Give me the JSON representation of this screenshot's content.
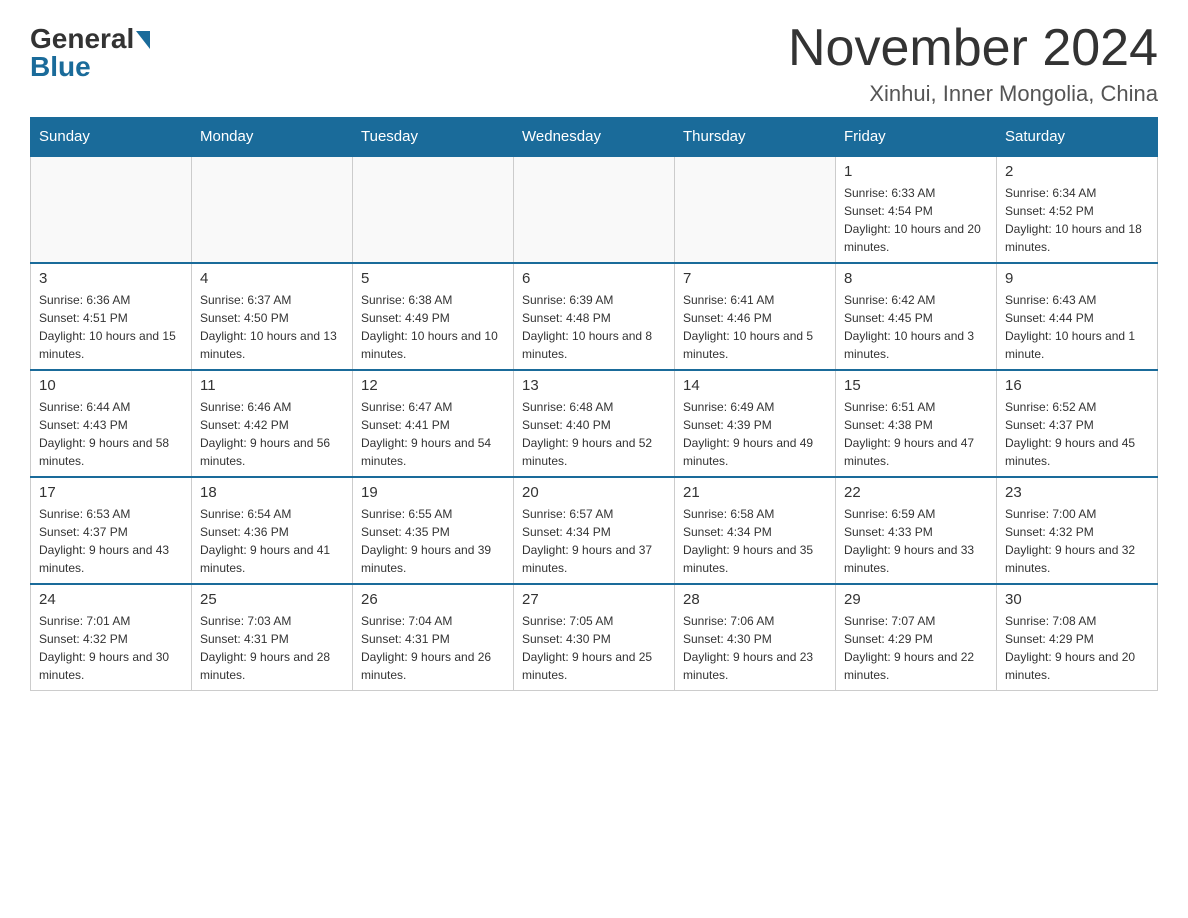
{
  "header": {
    "logo_general": "General",
    "logo_blue": "Blue",
    "month_title": "November 2024",
    "location": "Xinhui, Inner Mongolia, China"
  },
  "calendar": {
    "days_of_week": [
      "Sunday",
      "Monday",
      "Tuesday",
      "Wednesday",
      "Thursday",
      "Friday",
      "Saturday"
    ],
    "weeks": [
      [
        {
          "day": "",
          "info": ""
        },
        {
          "day": "",
          "info": ""
        },
        {
          "day": "",
          "info": ""
        },
        {
          "day": "",
          "info": ""
        },
        {
          "day": "",
          "info": ""
        },
        {
          "day": "1",
          "info": "Sunrise: 6:33 AM\nSunset: 4:54 PM\nDaylight: 10 hours and 20 minutes."
        },
        {
          "day": "2",
          "info": "Sunrise: 6:34 AM\nSunset: 4:52 PM\nDaylight: 10 hours and 18 minutes."
        }
      ],
      [
        {
          "day": "3",
          "info": "Sunrise: 6:36 AM\nSunset: 4:51 PM\nDaylight: 10 hours and 15 minutes."
        },
        {
          "day": "4",
          "info": "Sunrise: 6:37 AM\nSunset: 4:50 PM\nDaylight: 10 hours and 13 minutes."
        },
        {
          "day": "5",
          "info": "Sunrise: 6:38 AM\nSunset: 4:49 PM\nDaylight: 10 hours and 10 minutes."
        },
        {
          "day": "6",
          "info": "Sunrise: 6:39 AM\nSunset: 4:48 PM\nDaylight: 10 hours and 8 minutes."
        },
        {
          "day": "7",
          "info": "Sunrise: 6:41 AM\nSunset: 4:46 PM\nDaylight: 10 hours and 5 minutes."
        },
        {
          "day": "8",
          "info": "Sunrise: 6:42 AM\nSunset: 4:45 PM\nDaylight: 10 hours and 3 minutes."
        },
        {
          "day": "9",
          "info": "Sunrise: 6:43 AM\nSunset: 4:44 PM\nDaylight: 10 hours and 1 minute."
        }
      ],
      [
        {
          "day": "10",
          "info": "Sunrise: 6:44 AM\nSunset: 4:43 PM\nDaylight: 9 hours and 58 minutes."
        },
        {
          "day": "11",
          "info": "Sunrise: 6:46 AM\nSunset: 4:42 PM\nDaylight: 9 hours and 56 minutes."
        },
        {
          "day": "12",
          "info": "Sunrise: 6:47 AM\nSunset: 4:41 PM\nDaylight: 9 hours and 54 minutes."
        },
        {
          "day": "13",
          "info": "Sunrise: 6:48 AM\nSunset: 4:40 PM\nDaylight: 9 hours and 52 minutes."
        },
        {
          "day": "14",
          "info": "Sunrise: 6:49 AM\nSunset: 4:39 PM\nDaylight: 9 hours and 49 minutes."
        },
        {
          "day": "15",
          "info": "Sunrise: 6:51 AM\nSunset: 4:38 PM\nDaylight: 9 hours and 47 minutes."
        },
        {
          "day": "16",
          "info": "Sunrise: 6:52 AM\nSunset: 4:37 PM\nDaylight: 9 hours and 45 minutes."
        }
      ],
      [
        {
          "day": "17",
          "info": "Sunrise: 6:53 AM\nSunset: 4:37 PM\nDaylight: 9 hours and 43 minutes."
        },
        {
          "day": "18",
          "info": "Sunrise: 6:54 AM\nSunset: 4:36 PM\nDaylight: 9 hours and 41 minutes."
        },
        {
          "day": "19",
          "info": "Sunrise: 6:55 AM\nSunset: 4:35 PM\nDaylight: 9 hours and 39 minutes."
        },
        {
          "day": "20",
          "info": "Sunrise: 6:57 AM\nSunset: 4:34 PM\nDaylight: 9 hours and 37 minutes."
        },
        {
          "day": "21",
          "info": "Sunrise: 6:58 AM\nSunset: 4:34 PM\nDaylight: 9 hours and 35 minutes."
        },
        {
          "day": "22",
          "info": "Sunrise: 6:59 AM\nSunset: 4:33 PM\nDaylight: 9 hours and 33 minutes."
        },
        {
          "day": "23",
          "info": "Sunrise: 7:00 AM\nSunset: 4:32 PM\nDaylight: 9 hours and 32 minutes."
        }
      ],
      [
        {
          "day": "24",
          "info": "Sunrise: 7:01 AM\nSunset: 4:32 PM\nDaylight: 9 hours and 30 minutes."
        },
        {
          "day": "25",
          "info": "Sunrise: 7:03 AM\nSunset: 4:31 PM\nDaylight: 9 hours and 28 minutes."
        },
        {
          "day": "26",
          "info": "Sunrise: 7:04 AM\nSunset: 4:31 PM\nDaylight: 9 hours and 26 minutes."
        },
        {
          "day": "27",
          "info": "Sunrise: 7:05 AM\nSunset: 4:30 PM\nDaylight: 9 hours and 25 minutes."
        },
        {
          "day": "28",
          "info": "Sunrise: 7:06 AM\nSunset: 4:30 PM\nDaylight: 9 hours and 23 minutes."
        },
        {
          "day": "29",
          "info": "Sunrise: 7:07 AM\nSunset: 4:29 PM\nDaylight: 9 hours and 22 minutes."
        },
        {
          "day": "30",
          "info": "Sunrise: 7:08 AM\nSunset: 4:29 PM\nDaylight: 9 hours and 20 minutes."
        }
      ]
    ]
  }
}
